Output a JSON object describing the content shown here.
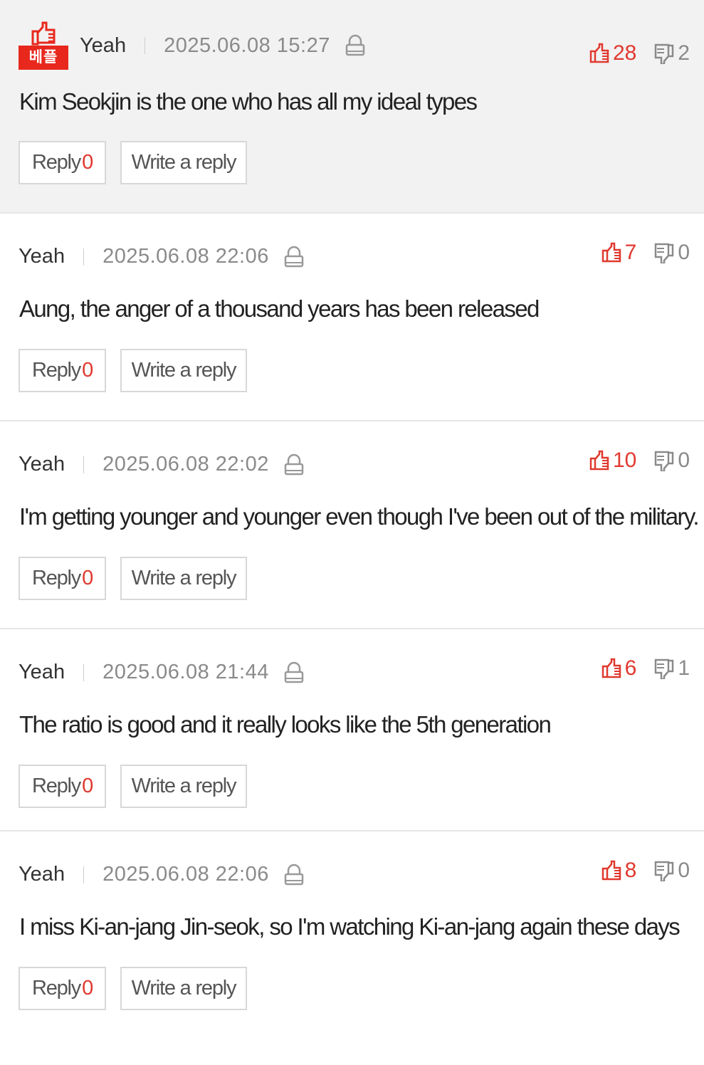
{
  "colors": {
    "accent": "#e0392f",
    "badge": "#e8281d",
    "best_bg": "#f2f2f2",
    "muted": "#8a8a8a"
  },
  "icons": {
    "best_badge": "thumbs-up-icon",
    "lock": "lock-icon",
    "like": "thumbs-up-icon",
    "dislike": "thumbs-down-icon"
  },
  "comments": [
    {
      "best_label": "베플",
      "nick": "Yeah",
      "date": "2025.06.08 15:27",
      "likes": "28",
      "dislikes": "2",
      "text": "Kim Seokjin is the one who has all my ideal types",
      "reply_label": "Reply",
      "reply_count": "0",
      "write_label": "Write a reply"
    },
    {
      "nick": "Yeah",
      "date": "2025.06.08 22:06",
      "likes": "7",
      "dislikes": "0",
      "text": "Aung, the anger of a thousand years has been released",
      "reply_label": "Reply",
      "reply_count": "0",
      "write_label": "Write a reply"
    },
    {
      "nick": "Yeah",
      "date": "2025.06.08 22:02",
      "likes": "10",
      "dislikes": "0",
      "text": "I'm getting younger and younger even though I've been out of the military.",
      "reply_label": "Reply",
      "reply_count": "0",
      "write_label": "Write a reply"
    },
    {
      "nick": "Yeah",
      "date": "2025.06.08 21:44",
      "likes": "6",
      "dislikes": "1",
      "text": "The ratio is good and it really looks like the 5th generation",
      "reply_label": "Reply",
      "reply_count": "0",
      "write_label": "Write a reply"
    },
    {
      "nick": "Yeah",
      "date": "2025.06.08 22:06",
      "likes": "8",
      "dislikes": "0",
      "text": "I miss Ki-an-jang Jin-seok, so I'm watching Ki-an-jang again these days",
      "reply_label": "Reply",
      "reply_count": "0",
      "write_label": "Write a reply"
    }
  ]
}
